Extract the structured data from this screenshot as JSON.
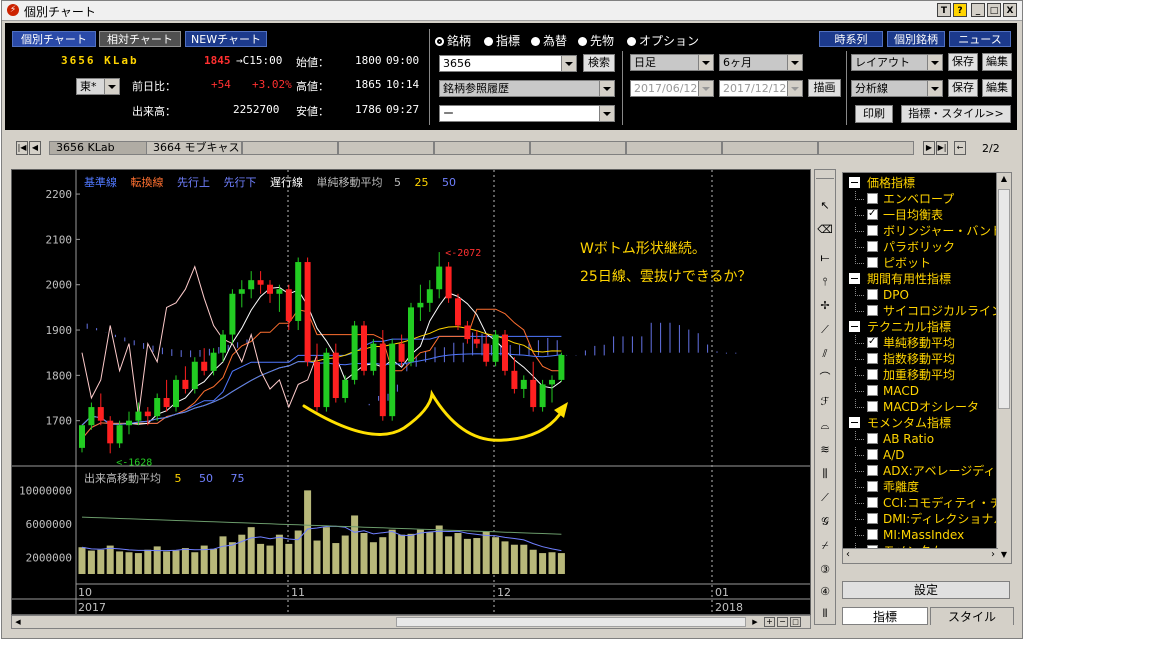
{
  "window": {
    "title": "個別チャート",
    "buttons": [
      "T",
      "?",
      "_",
      "□",
      "X"
    ]
  },
  "nav": {
    "tabs": [
      "個別チャート",
      "相対チャート",
      "NEWチャート"
    ],
    "right": [
      "時系列",
      "個別銘柄",
      "ニュース"
    ]
  },
  "quote": {
    "code_name": "3656 KLab",
    "price": "1845",
    "time": "→C15:00",
    "exchange": "東*",
    "change_label": "前日比：",
    "change": "+54",
    "change_pct": "+3.02%",
    "volume_label": "出来高：",
    "volume": "2252700",
    "open_label": "始値：",
    "open": "1800",
    "open_time": "09:00",
    "high_label": "高値：",
    "high": "1865",
    "high_time": "10:14",
    "low_label": "安値：",
    "low": "1786",
    "low_time": "09:27"
  },
  "modes": [
    {
      "label": "銘柄",
      "selected": true
    },
    {
      "label": "指標",
      "selected": false
    },
    {
      "label": "為替",
      "selected": false
    },
    {
      "label": "先物",
      "selected": false
    },
    {
      "label": "オプション",
      "selected": false
    }
  ],
  "search": {
    "code": "3656",
    "search_button": "検索",
    "history": "銘柄参照履歴",
    "third": "ー"
  },
  "period": {
    "interval": "日足",
    "span": "6ヶ月",
    "from": "2017/06/12",
    "to": "2017/12/12",
    "draw_button": "描画"
  },
  "layout": {
    "layout_label": "レイアウト",
    "save": "保存",
    "edit": "編集",
    "analysis_label": "分析線",
    "print": "印刷",
    "style_button": "指標・スタイル>>"
  },
  "tabstrip": {
    "tabs": [
      "3656 KLab",
      "3664 モブキャス"
    ],
    "page": "2/2"
  },
  "legend": {
    "items": [
      {
        "label": "基準線",
        "color": "#5078ff"
      },
      {
        "label": "転換線",
        "color": "#ff7030"
      },
      {
        "label": "先行上",
        "color": "#7080ff"
      },
      {
        "label": "先行下",
        "color": "#7080ff"
      },
      {
        "label": "遅行線",
        "color": "#ffffff"
      }
    ],
    "sma_label": "単純移動平均",
    "sma": [
      {
        "label": "5",
        "color": "#ffffff"
      },
      {
        "label": "25",
        "color": "#ffd400"
      },
      {
        "label": "50",
        "color": "#5078ff"
      }
    ],
    "vol_label": "出来高移動平均",
    "vol_ma": [
      {
        "label": "5",
        "color": "#ffd400"
      },
      {
        "label": "50",
        "color": "#7080ff"
      },
      {
        "label": "75",
        "color": "#7080ff"
      }
    ]
  },
  "annotations": {
    "line1": "Wボトム形状継続。",
    "line2": "25日線、雲抜けできるか？",
    "peak": "2072",
    "trough": "1628"
  },
  "chart_data": {
    "type": "candlestick",
    "price_axis": {
      "ticks": [
        "2200",
        "2100",
        "2000",
        "1900",
        "1800",
        "1700"
      ],
      "min": 1600,
      "max": 2220
    },
    "volume_axis": {
      "ticks": [
        "10000000",
        "6000000",
        "2000000"
      ]
    },
    "x_labels": [
      "10",
      "2017",
      "11",
      "12",
      "01",
      "2018"
    ],
    "candles": [
      [
        1640,
        1690,
        1630,
        1690
      ],
      [
        1690,
        1740,
        1680,
        1730
      ],
      [
        1730,
        1760,
        1690,
        1700
      ],
      [
        1700,
        1710,
        1628,
        1650
      ],
      [
        1650,
        1700,
        1640,
        1690
      ],
      [
        1690,
        1720,
        1670,
        1700
      ],
      [
        1700,
        1740,
        1690,
        1720
      ],
      [
        1720,
        1730,
        1690,
        1710
      ],
      [
        1710,
        1760,
        1700,
        1750
      ],
      [
        1750,
        1790,
        1720,
        1730
      ],
      [
        1730,
        1800,
        1720,
        1790
      ],
      [
        1790,
        1820,
        1760,
        1770
      ],
      [
        1770,
        1840,
        1760,
        1830
      ],
      [
        1830,
        1860,
        1800,
        1810
      ],
      [
        1810,
        1860,
        1800,
        1850
      ],
      [
        1850,
        1900,
        1830,
        1890
      ],
      [
        1890,
        1990,
        1870,
        1980
      ],
      [
        1980,
        2010,
        1950,
        1990
      ],
      [
        1990,
        2030,
        1970,
        2010
      ],
      [
        2010,
        2030,
        1980,
        2000
      ],
      [
        2000,
        2010,
        1960,
        1980
      ],
      [
        1980,
        2000,
        1940,
        1990
      ],
      [
        1990,
        2000,
        1900,
        1920
      ],
      [
        1920,
        2060,
        1900,
        2050
      ],
      [
        2050,
        2060,
        1820,
        1830
      ],
      [
        1830,
        1870,
        1720,
        1730
      ],
      [
        1730,
        1860,
        1720,
        1850
      ],
      [
        1850,
        1870,
        1740,
        1750
      ],
      [
        1750,
        1800,
        1740,
        1790
      ],
      [
        1790,
        1920,
        1780,
        1910
      ],
      [
        1910,
        1920,
        1800,
        1810
      ],
      [
        1810,
        1880,
        1800,
        1870
      ],
      [
        1870,
        1900,
        1700,
        1710
      ],
      [
        1710,
        1880,
        1700,
        1870
      ],
      [
        1870,
        1890,
        1820,
        1830
      ],
      [
        1830,
        1960,
        1820,
        1950
      ],
      [
        1950,
        2000,
        1920,
        1960
      ],
      [
        1960,
        2010,
        1940,
        1990
      ],
      [
        1990,
        2072,
        1970,
        2040
      ],
      [
        2040,
        2050,
        1960,
        1970
      ],
      [
        1970,
        1980,
        1900,
        1910
      ],
      [
        1910,
        1920,
        1870,
        1880
      ],
      [
        1880,
        1900,
        1860,
        1870
      ],
      [
        1870,
        1890,
        1820,
        1830
      ],
      [
        1830,
        1900,
        1820,
        1890
      ],
      [
        1890,
        1900,
        1800,
        1810
      ],
      [
        1810,
        1840,
        1760,
        1770
      ],
      [
        1770,
        1800,
        1750,
        1790
      ],
      [
        1790,
        1830,
        1720,
        1730
      ],
      [
        1730,
        1790,
        1720,
        1780
      ],
      [
        1780,
        1800,
        1740,
        1790
      ],
      [
        1790,
        1850,
        1786,
        1845
      ]
    ],
    "volumes": [
      3.2,
      2.8,
      2.9,
      3.4,
      2.7,
      2.6,
      2.5,
      2.9,
      3.3,
      2.7,
      2.8,
      3.1,
      2.6,
      3.4,
      3.0,
      4.5,
      3.8,
      4.7,
      5.6,
      3.6,
      3.4,
      4.7,
      3.6,
      5.2,
      10.0,
      4.0,
      5.6,
      3.7,
      4.6,
      7.0,
      4.9,
      3.8,
      4.4,
      5.3,
      4.7,
      4.8,
      5.3,
      5.0,
      5.8,
      4.5,
      4.9,
      4.2,
      4.3,
      5.1,
      4.4,
      3.9,
      3.5,
      3.5,
      2.9,
      2.5,
      2.6,
      2.5
    ]
  },
  "panel": {
    "tree": [
      {
        "type": "group",
        "label": "価格指標"
      },
      {
        "type": "item",
        "label": "エンベロープ",
        "checked": false
      },
      {
        "type": "item",
        "label": "一目均衡表",
        "checked": true
      },
      {
        "type": "item",
        "label": "ボリンジャー・バンド",
        "checked": false
      },
      {
        "type": "item",
        "label": "パラボリック",
        "checked": false
      },
      {
        "type": "item",
        "label": "ピボット",
        "checked": false
      },
      {
        "type": "group",
        "label": "期間有用性指標"
      },
      {
        "type": "item",
        "label": "DPO",
        "checked": false
      },
      {
        "type": "item",
        "label": "サイコロジカルライン",
        "checked": false
      },
      {
        "type": "group",
        "label": "テクニカル指標"
      },
      {
        "type": "item",
        "label": "単純移動平均",
        "checked": true
      },
      {
        "type": "item",
        "label": "指数移動平均",
        "checked": false
      },
      {
        "type": "item",
        "label": "加重移動平均",
        "checked": false
      },
      {
        "type": "item",
        "label": "MACD",
        "checked": false
      },
      {
        "type": "item",
        "label": "MACDオシレータ",
        "checked": false
      },
      {
        "type": "group",
        "label": "モメンタム指標"
      },
      {
        "type": "item",
        "label": "AB Ratio",
        "checked": false
      },
      {
        "type": "item",
        "label": "A/D",
        "checked": false
      },
      {
        "type": "item",
        "label": "ADX:アベレージディレ",
        "checked": false
      },
      {
        "type": "item",
        "label": "乖離度",
        "checked": false
      },
      {
        "type": "item",
        "label": "CCI:コモディティ・チャ",
        "checked": false
      },
      {
        "type": "item",
        "label": "DMI:ディレクショナル",
        "checked": false
      },
      {
        "type": "item",
        "label": "MI:MassIndex",
        "checked": false
      },
      {
        "type": "item",
        "label": "モメンタム",
        "checked": false
      }
    ],
    "settings_button": "設定",
    "tabs": [
      "指標",
      "スタイル"
    ]
  }
}
